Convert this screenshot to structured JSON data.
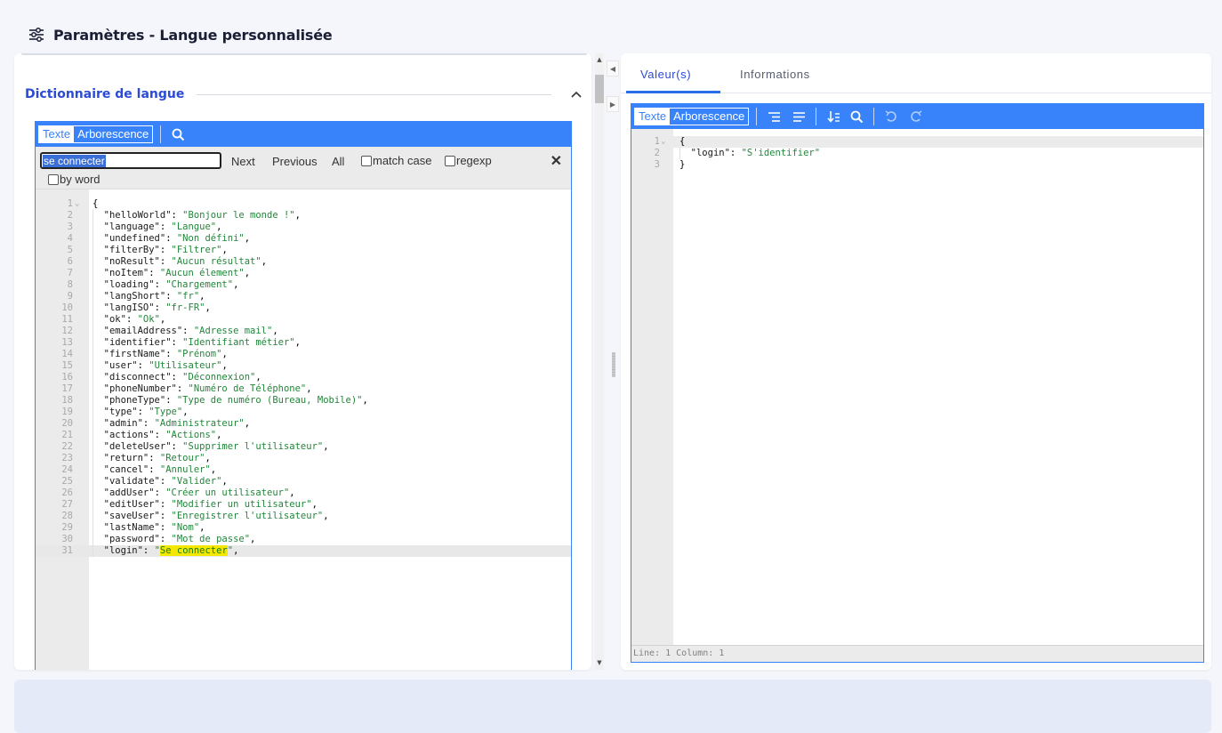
{
  "header": {
    "title": "Paramètres - Langue personnalisée",
    "icon": "sliders-icon"
  },
  "left_panel": {
    "section_title": "Dictionnaire de langue",
    "editor": {
      "modes": [
        "Texte",
        "Arborescence"
      ],
      "active_mode": "Texte",
      "search": {
        "value": "se connecter",
        "next_label": "Next",
        "previous_label": "Previous",
        "all_label": "All",
        "match_case_label": "match case",
        "regexp_label": "regexp",
        "by_word_label": "by word",
        "close_label": "✕"
      },
      "lines": [
        {
          "n": "1",
          "open": "{"
        },
        {
          "n": "2",
          "k": "helloWorld",
          "v": "Bonjour le monde !"
        },
        {
          "n": "3",
          "k": "language",
          "v": "Langue"
        },
        {
          "n": "4",
          "k": "undefined",
          "v": "Non défini"
        },
        {
          "n": "5",
          "k": "filterBy",
          "v": "Filtrer"
        },
        {
          "n": "6",
          "k": "noResult",
          "v": "Aucun résultat"
        },
        {
          "n": "7",
          "k": "noItem",
          "v": "Aucun élement"
        },
        {
          "n": "8",
          "k": "loading",
          "v": "Chargement"
        },
        {
          "n": "9",
          "k": "langShort",
          "v": "fr"
        },
        {
          "n": "10",
          "k": "langISO",
          "v": "fr-FR"
        },
        {
          "n": "11",
          "k": "ok",
          "v": "Ok"
        },
        {
          "n": "12",
          "k": "emailAddress",
          "v": "Adresse mail"
        },
        {
          "n": "13",
          "k": "identifier",
          "v": "Identifiant métier"
        },
        {
          "n": "14",
          "k": "firstName",
          "v": "Prénom"
        },
        {
          "n": "15",
          "k": "user",
          "v": "Utilisateur"
        },
        {
          "n": "16",
          "k": "disconnect",
          "v": "Déconnexion"
        },
        {
          "n": "17",
          "k": "phoneNumber",
          "v": "Numéro de Téléphone"
        },
        {
          "n": "18",
          "k": "phoneType",
          "v": "Type de numéro (Bureau, Mobile)"
        },
        {
          "n": "19",
          "k": "type",
          "v": "Type"
        },
        {
          "n": "20",
          "k": "admin",
          "v": "Administrateur"
        },
        {
          "n": "21",
          "k": "actions",
          "v": "Actions"
        },
        {
          "n": "22",
          "k": "deleteUser",
          "v": "Supprimer l'utilisateur"
        },
        {
          "n": "23",
          "k": "return",
          "v": "Retour"
        },
        {
          "n": "24",
          "k": "cancel",
          "v": "Annuler"
        },
        {
          "n": "25",
          "k": "validate",
          "v": "Valider"
        },
        {
          "n": "26",
          "k": "addUser",
          "v": "Créer un utilisateur"
        },
        {
          "n": "27",
          "k": "editUser",
          "v": "Modifier un utilisateur"
        },
        {
          "n": "28",
          "k": "saveUser",
          "v": "Enregistrer l'utilisateur"
        },
        {
          "n": "29",
          "k": "lastName",
          "v": "Nom"
        },
        {
          "n": "30",
          "k": "password",
          "v": "Mot de passe"
        },
        {
          "n": "31",
          "k": "login",
          "v": "Se connecter",
          "highlight": true
        }
      ]
    }
  },
  "right_panel": {
    "tabs": [
      "Valeur(s)",
      "Informations"
    ],
    "active_tab": "Valeur(s)",
    "editor": {
      "modes": [
        "Texte",
        "Arborescence"
      ],
      "active_mode": "Texte",
      "lines": [
        {
          "n": "1",
          "open": "{"
        },
        {
          "n": "2",
          "k": "login",
          "v": "S'identifier"
        },
        {
          "n": "3",
          "close": "}"
        }
      ],
      "status": "Line: 1  Column: 1"
    }
  },
  "colors": {
    "accent": "#3883fa",
    "brand": "#2b4bd6",
    "highlight": "#f4e800",
    "string": "#22863a"
  }
}
